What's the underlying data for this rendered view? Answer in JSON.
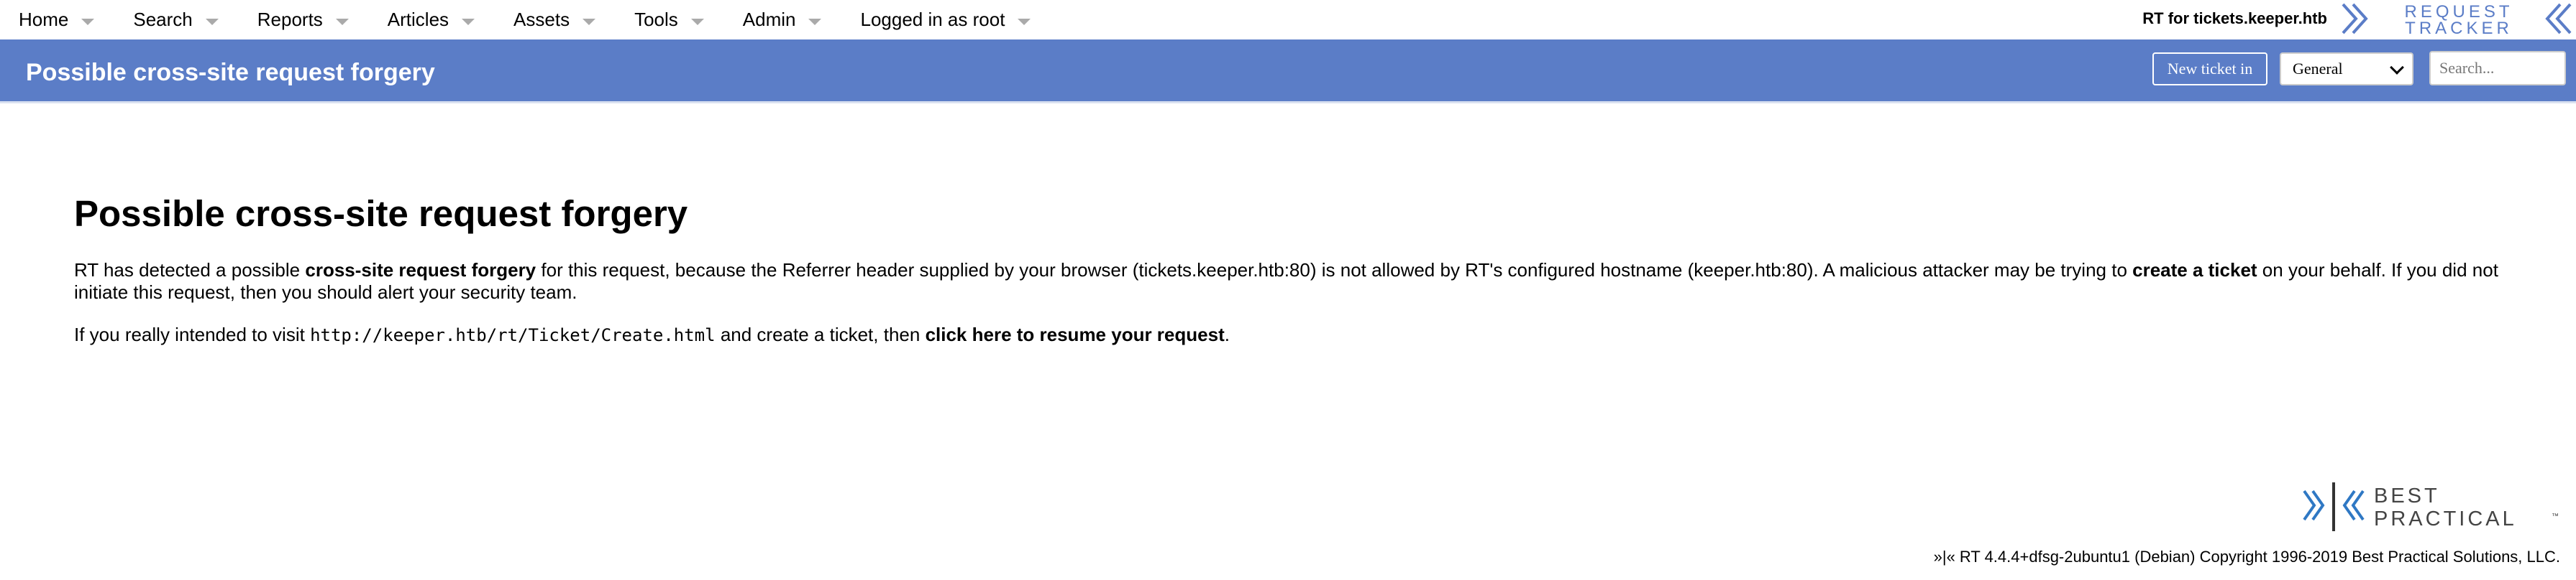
{
  "menu": {
    "items": [
      {
        "label": "Home"
      },
      {
        "label": "Search"
      },
      {
        "label": "Reports"
      },
      {
        "label": "Articles"
      },
      {
        "label": "Assets"
      },
      {
        "label": "Tools"
      },
      {
        "label": "Admin"
      },
      {
        "label": "Logged in as root"
      }
    ]
  },
  "topbar": {
    "rt_name": "RT for tickets.keeper.htb",
    "logo": {
      "line1": "REQUEST",
      "line2": "TRACKER"
    }
  },
  "header": {
    "title": "Possible cross-site request forgery",
    "new_ticket_label": "New ticket in",
    "queue_selected": "General",
    "search_placeholder": "Search..."
  },
  "content": {
    "heading": "Possible cross-site request forgery",
    "p1_a": "RT has detected a possible ",
    "p1_b": "cross-site request forgery",
    "p1_c": " for this request, because the Referrer header supplied by your browser (tickets.keeper.htb:80) is not allowed by RT's configured hostname (keeper.htb:80). A malicious attacker may be trying to ",
    "p1_d": "create a ticket",
    "p1_e": " on your behalf. If you did not initiate this request, then you should alert your security team.",
    "p2_a": "If you really intended to visit ",
    "p2_url": "http://keeper.htb/rt/Ticket/Create.html",
    "p2_b": " and create a ticket, then ",
    "p2_link": "click here to resume your request",
    "p2_c": "."
  },
  "footer": {
    "logo": {
      "line1": "BEST",
      "line2": "PRACTICAL",
      "tm": "™"
    },
    "text": "»|« RT 4.4.4+dfsg-2ubuntu1 (Debian) Copyright 1996-2019 Best Practical Solutions, LLC."
  },
  "colors": {
    "header_blue": "#5b7dc7",
    "logo_blue": "#5b7dc7",
    "bp_blue": "#2f78c4",
    "text": "#000000"
  }
}
